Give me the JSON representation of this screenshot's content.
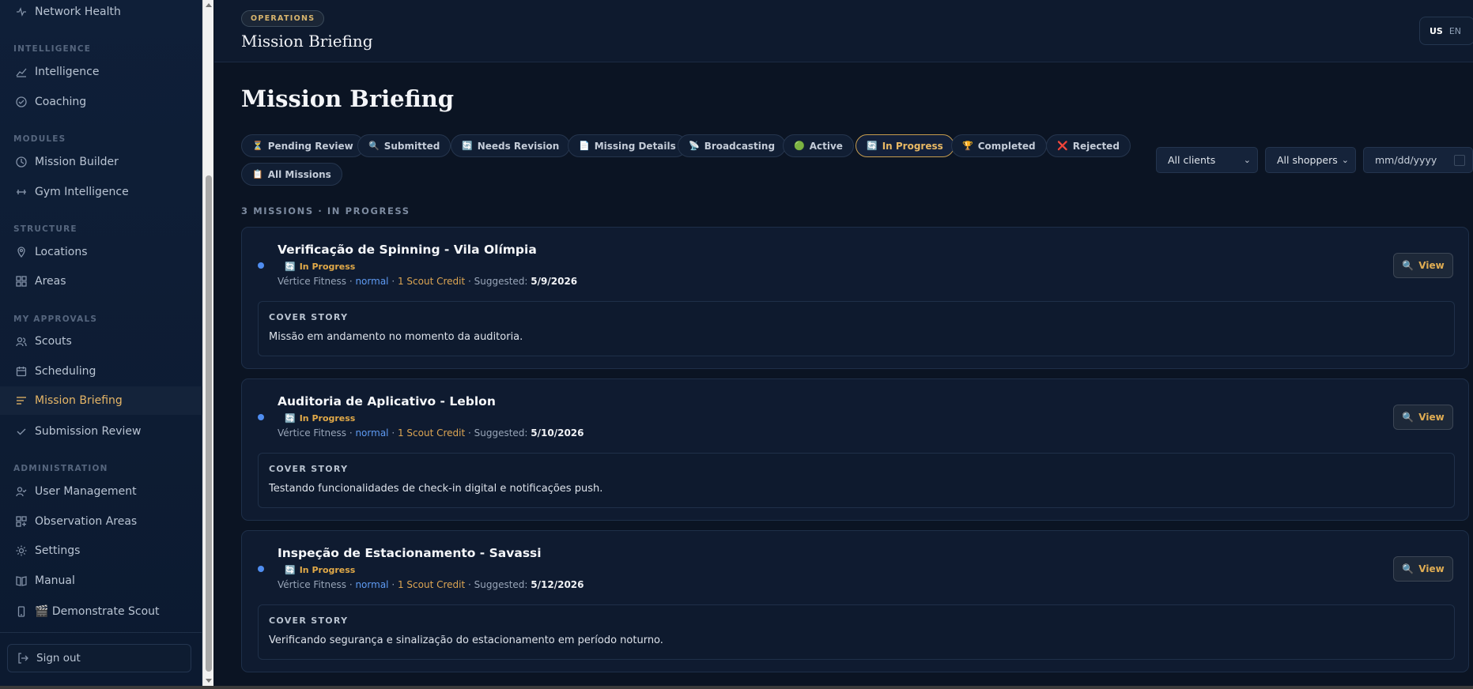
{
  "sidebar": {
    "items": [
      {
        "label": "Network Health",
        "icon": "pulse-icon"
      },
      {
        "label": "Intelligence",
        "icon": "trend-chart-icon"
      },
      {
        "label": "Coaching",
        "icon": "check-circle-icon"
      },
      {
        "label": "Mission Builder",
        "icon": "clock-icon"
      },
      {
        "label": "Gym Intelligence",
        "icon": "dumbbell-icon"
      },
      {
        "label": "Locations",
        "icon": "map-pin-icon"
      },
      {
        "label": "Areas",
        "icon": "grid-icon"
      },
      {
        "label": "Scouts",
        "icon": "users-icon"
      },
      {
        "label": "Scheduling",
        "icon": "calendar-icon"
      },
      {
        "label": "Mission Briefing",
        "icon": "list-lines-icon",
        "active": true
      },
      {
        "label": "Submission Review",
        "icon": "check-icon"
      },
      {
        "label": "User Management",
        "icon": "user-check-icon"
      },
      {
        "label": "Observation Areas",
        "icon": "grid-plus-icon"
      },
      {
        "label": "Settings",
        "icon": "sun-gear-icon"
      },
      {
        "label": "Manual",
        "icon": "book-icon"
      },
      {
        "label": "🎬 Demonstrate Scout",
        "icon": "phone-icon"
      }
    ],
    "sections": {
      "intelligence": "INTELLIGENCE",
      "modules": "MODULES",
      "structure": "STRUCTURE",
      "approvals": "MY APPROVALS",
      "administration": "ADMINISTRATION"
    },
    "signout_label": "Sign out"
  },
  "header": {
    "badge": "OPERATIONS",
    "title": "Mission Briefing",
    "lang_flag": "US",
    "lang_code": "EN"
  },
  "main": {
    "title": "Mission Briefing",
    "filters": [
      {
        "emoji": "⏳",
        "label": "Pending Review"
      },
      {
        "emoji": "🔍",
        "label": "Submitted"
      },
      {
        "emoji": "🔄",
        "label": "Needs Revision"
      },
      {
        "emoji": "📄",
        "label": "Missing Details"
      },
      {
        "emoji": "📡",
        "label": "Broadcasting"
      },
      {
        "emoji": "🟢",
        "label": "Active"
      },
      {
        "emoji": "🔄",
        "label": "In Progress",
        "active": true
      },
      {
        "emoji": "🏆",
        "label": "Completed"
      },
      {
        "emoji": "❌",
        "label": "Rejected"
      },
      {
        "emoji": "📋",
        "label": "All Missions"
      }
    ],
    "client_select": "All clients",
    "shopper_select": "All shoppers",
    "date_placeholder": "mm/dd/yyyy",
    "count_line": "3 MISSIONS · IN PROGRESS",
    "missions": [
      {
        "title": "Verificação de Spinning - Vila Olímpia",
        "status": "In Progress",
        "client": "Vértice Fitness",
        "priority": "normal",
        "credit": "1 Scout Credit",
        "suggested_label": "Suggested:",
        "date": "5/9/2026",
        "cover_label": "COVER STORY",
        "cover_text": "Missão em andamento no momento da auditoria.",
        "view_label": "View"
      },
      {
        "title": "Auditoria de Aplicativo - Leblon",
        "status": "In Progress",
        "client": "Vértice Fitness",
        "priority": "normal",
        "credit": "1 Scout Credit",
        "suggested_label": "Suggested:",
        "date": "5/10/2026",
        "cover_label": "COVER STORY",
        "cover_text": "Testando funcionalidades de check-in digital e notificações push.",
        "view_label": "View"
      },
      {
        "title": "Inspeção de Estacionamento - Savassi",
        "status": "In Progress",
        "client": "Vértice Fitness",
        "priority": "normal",
        "credit": "1 Scout Credit",
        "suggested_label": "Suggested:",
        "date": "5/12/2026",
        "cover_label": "COVER STORY",
        "cover_text": "Verificando segurança e sinalização do estacionamento em período noturno.",
        "view_label": "View"
      }
    ]
  },
  "colors": {
    "accent": "#e6b667",
    "background": "#0b1423",
    "priority": "#5e9af2",
    "status": "#e1a948"
  }
}
